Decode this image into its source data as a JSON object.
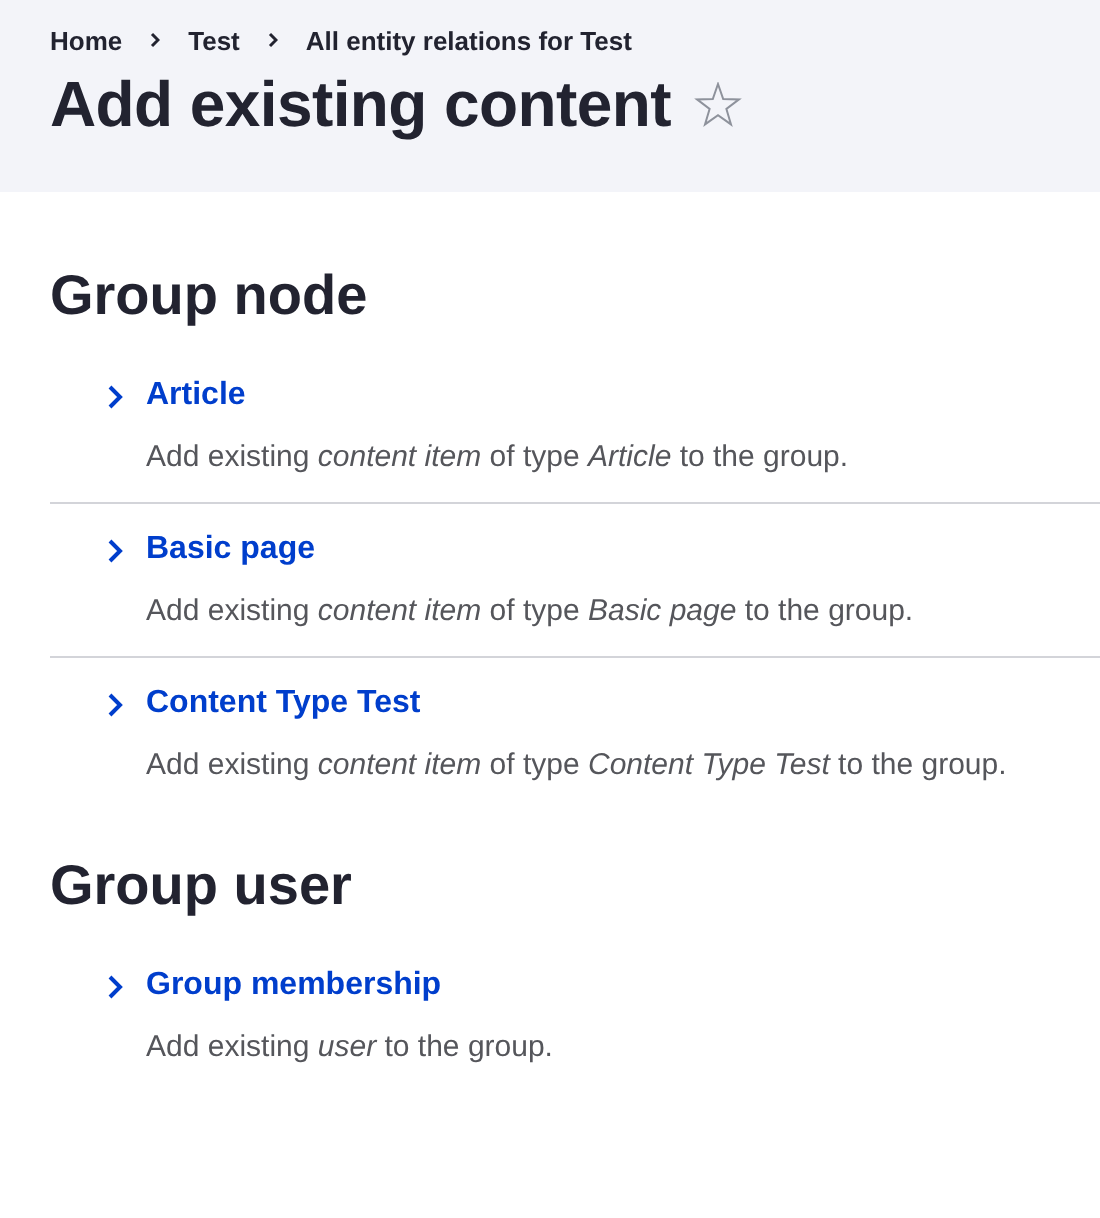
{
  "breadcrumb": [
    "Home",
    "Test",
    "All entity relations for Test"
  ],
  "title": "Add existing content",
  "sections": [
    {
      "heading": "Group node",
      "items": [
        {
          "label": "Article",
          "description": "Add existing *content item* of type *Article* to the group."
        },
        {
          "label": "Basic page",
          "description": "Add existing *content item* of type *Basic page* to the group."
        },
        {
          "label": "Content Type Test",
          "description": "Add existing *content item* of type *Content Type Test* to the group."
        }
      ]
    },
    {
      "heading": "Group user",
      "items": [
        {
          "label": "Group membership",
          "description": "Add existing *user* to the group."
        }
      ]
    }
  ]
}
